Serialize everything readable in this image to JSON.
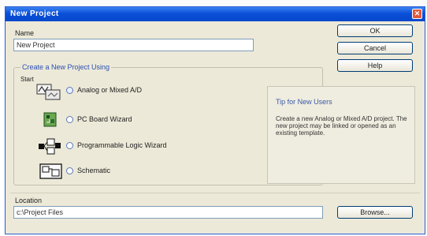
{
  "window": {
    "title": "New Project"
  },
  "name_section": {
    "label": "Name",
    "value": "New Project"
  },
  "buttons": {
    "ok": "OK",
    "cancel": "Cancel",
    "help": "Help",
    "browse": "Browse..."
  },
  "group": {
    "title": "Create a New Project Using",
    "caption": "Start",
    "options": [
      {
        "label": "Analog or Mixed A/D",
        "icon": "analog-circuit-icon",
        "selected": true
      },
      {
        "label": "PC Board Wizard",
        "icon": "pc-board-icon",
        "selected": false
      },
      {
        "label": "Programmable Logic Wizard",
        "icon": "programmable-logic-icon",
        "selected": false
      },
      {
        "label": "Schematic",
        "icon": "schematic-icon",
        "selected": false
      }
    ]
  },
  "description": {
    "title": "Tip for New Users",
    "body": "Create a new Analog or Mixed A/D project. The new project may be linked or opened as an existing template."
  },
  "location_section": {
    "label": "Location",
    "value": "c:\\Project Files"
  },
  "colors": {
    "titlebar": "#0a4fd8",
    "dialog_bg": "#ece9d8",
    "close_button": "#e2573c",
    "group_title": "#2a4fb3"
  }
}
